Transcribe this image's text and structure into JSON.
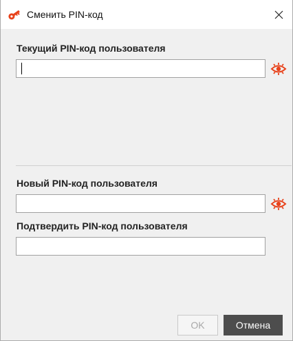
{
  "window": {
    "title": "Сменить PIN-код",
    "title_icon": "key-icon",
    "close_icon": "close-icon"
  },
  "current_pin": {
    "label": "Текущий PIN-код пользователя",
    "value": "",
    "reveal_icon": "eye-icon"
  },
  "new_pin": {
    "label": "Новый PIN-код пользователя",
    "value": "",
    "reveal_icon": "eye-icon"
  },
  "confirm_pin": {
    "label": "Подтвердить PIN-код пользователя",
    "value": ""
  },
  "buttons": {
    "ok": "OK",
    "cancel": "Отмена"
  },
  "colors": {
    "accent": "#e8431c",
    "cancel_bg": "#4d4d4d",
    "dialog_bg": "#f0f0f0"
  }
}
